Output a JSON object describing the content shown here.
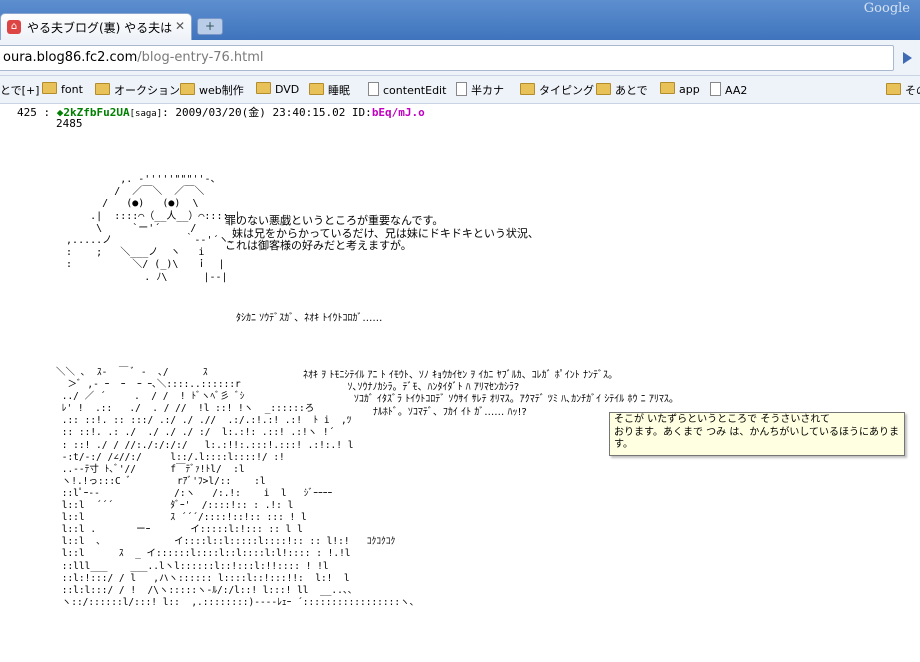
{
  "browser": {
    "tab_title": "やる夫ブログ(裏) やる夫は…",
    "tab_close": "✕",
    "new_tab": "+",
    "brand": "Google",
    "url_host": "oura.blog86.fc2.com",
    "url_path": "/blog-entry-76.html"
  },
  "bookmarks": [
    {
      "label": "とで[+]",
      "type": "none"
    },
    {
      "label": "font",
      "type": "folder"
    },
    {
      "label": "オークション",
      "type": "folder"
    },
    {
      "label": "web制作",
      "type": "folder"
    },
    {
      "label": "DVD",
      "type": "folder"
    },
    {
      "label": "睡眠",
      "type": "folder"
    },
    {
      "label": "contentEdit",
      "type": "page"
    },
    {
      "label": "半カナ",
      "type": "page"
    },
    {
      "label": "タイピング",
      "type": "folder"
    },
    {
      "label": "あとで",
      "type": "folder"
    },
    {
      "label": "app",
      "type": "folder"
    },
    {
      "label": "AA2",
      "type": "page"
    },
    {
      "label": "その",
      "type": "folder"
    }
  ],
  "post": {
    "number": "425 :",
    "name": "◆2kZfbFu2UA",
    "mail": "[saga]",
    "date": ": 2009/03/20(金) 23:40:15.02 ID:",
    "id": "bEq/mJ.o",
    "seq": "2485"
  },
  "aa1": "           ,. ‐'''''\"\"\"''‐、\n          /  ／￣＼  ／￣＼\n        /   (●)   (●)  \\\n      .|  ::::⌒（__人__）⌒:::: |\n       \\     `ー'´     /\n  ,.....ノ            ｀‐‐'´ヽ、\n  :    ;   ＼___ノ  ヽ   i\n  :          ＼/ (_)\\   ｉ  |\n               . ﾉ\\      |‐‐|",
  "speech1": "罪のない悪戯というところが重要なんです。\n  妹は兄をからかっているだけ、兄は妹にドキドキという状況、\nこれは御客様の好みだと考えますが。",
  "speech2": "ﾀｼｶﾆ ｿｳﾃﾞｽｶﾞ、ﾈｵｷ ﾄｲｳﾄｺﾛｶﾞ……",
  "aa2": "＼＼ ､  ｽ-  ￣ ﾞ -  ､/      ｽ\n  ＞ﾞ ,- ｰ  ｰ  ｰ ｰ､＼::::..::::::r\n ../ ／ ´     .  / /  ! ﾄﾞヽﾍﾞ彡 ﾞｼ\n ﾚ' !  .::   ./  . / //  !l ::! !ヽ  _::::::ろ\n .:: ::!. :: :::/ .:/ ./ .//  .:/.:!.:! .:!  ﾄ i  ,ﾂ\n :: ::!. .: ./  ./ ./ ./ :/  l:.:!: .::! .:!ヽ !´\n : ::! ./ / //:./:/:/:/   l:.:!!:.:::!.:::! .:!:.! l\n -:t/-:/ /∠//:/     l::/.l::::l::::!/ :!\n ..--ﾃ寸 ﾄ､ﾞ'//      f￣ﾃﾞｧ!ﾄl/  :l\n ヽ!.!っ:::C ﾞ        rｱﾞ'ﾌ>l/::    :l\n ::lﾟｰ--             /:ヽ   /:.!:    i  l   ｼﾞｰｰｰｰ\n l::l  ´´´          ﾀﾞｰ'  /::::!:: : .!: l\n l::l               ｽ ´´´/::::!::!:: ::: ! l\n l::l .       ーｰ       イ:::::l:!::: :: l l\n l::l  、            イ::::l::l:::::l::::!:: :: l!:!   ｺｸｺｸｺｸ\n l::l      ｽ  _ イ::::::l::::l::l::::l:l!:::: : !.!l\n ::lll___    ___..lヽl::::::l::!:::l:!!:::: ! !l\n ::l:!:::/ / l   ,ハヽ:::::: l::::l::!:::!!:  l:!  l\n ::l:l:::/ / !  /\\ヽ:::::ヽ-ﾙ/:/l::! l:::! ll  __..、、\n ヽ::/::::::l/:::! l::  ,.::::::::)----ﾚｪｰ ´:::::::::::::::::ヽ、",
  "speech3": "ﾈｵｷ ｦ ﾄﾓﾆｼﾃｲﾙ ｱﾆ ﾄ ｲﾓｳﾄ、ｿﾉ ｷｮｳｶｲｾﾝ ｦ ｲｶﾆ ﾔﾌﾞﾙｶ、ｺﾚｶﾞ ﾎﾟｲﾝﾄ ﾅﾝﾃﾞｽ。\n              ｿ､ｿｳﾅﾉｶｼﾗ。ﾃﾞﾓ、ﾊﾝﾀｲﾀﾞﾄ ﾊ ｱﾘﾏｾﾝｶｼﾗ?\n                ｿｺｶﾞ ｲﾀｽﾞﾗ ﾄｲｳﾄｺﾛﾃﾞ ｿｳｻｲ ｻﾚﾃ ｵﾘﾏｽ。ｱｸﾏﾃﾞ ﾂﾐ ﾊ､ｶﾝﾁｶﾞｲ ｼﾃｲﾙ ﾎｳ ﾆ ｱﾘﾏｽ。\n                      ﾅﾙﾎﾄﾞ。ｿｺﾏﾃﾞ、ﾌｶｲ ｲﾄ ｶﾞ…… ﾊｯ!?",
  "tooltip": "そこが いたずらというところで そうさいされて\nおります。あくまで つみ は、かんちがいしているほうにありま\nす。"
}
